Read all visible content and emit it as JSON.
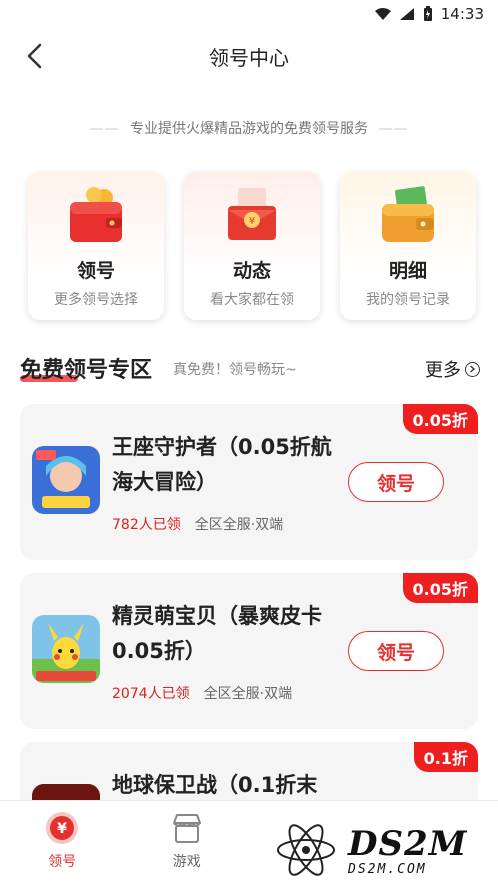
{
  "status_bar": {
    "time": "14:33"
  },
  "header": {
    "title": "领号中心"
  },
  "slogan": {
    "dash": "——",
    "text": "专业提供火爆精品游戏的免费领号服务"
  },
  "entry_cards": [
    {
      "name": "领号",
      "sub": "更多领号选择",
      "icon": "wallet-icon"
    },
    {
      "name": "动态",
      "sub": "看大家都在领",
      "icon": "red-envelope-icon"
    },
    {
      "name": "明细",
      "sub": "我的领号记录",
      "icon": "money-wallet-icon"
    }
  ],
  "section": {
    "title": "免费领号专区",
    "subtitle": "真免费！领号畅玩~",
    "more": "更多"
  },
  "games": [
    {
      "name": "王座守护者（0.05折航海大冒险）",
      "badge": "0.05折",
      "count": "782人已领",
      "tags": "全区全服·双端",
      "claim": "领号"
    },
    {
      "name": "精灵萌宝贝（暴爽皮卡0.05折）",
      "badge": "0.05折",
      "count": "2074人已领",
      "tags": "全区全服·双端",
      "claim": "领号"
    },
    {
      "name": "地球保卫战（0.1折末",
      "badge": "0.1折",
      "count": "",
      "tags": "",
      "claim": ""
    }
  ],
  "bottom_nav": [
    {
      "label": "领号",
      "icon": "yen-badge-icon",
      "active": true
    },
    {
      "label": "游戏",
      "icon": "shop-icon",
      "active": false
    },
    {
      "label": "",
      "icon": "gift-icon",
      "active": false
    },
    {
      "label": "",
      "icon": "user-icon",
      "active": false
    }
  ],
  "watermark": {
    "big": "DS2M",
    "small": "DS2M.COM"
  },
  "colors": {
    "accent": "#e53030",
    "badge": "#f01f1f",
    "card_bg": "#f5f5f5"
  }
}
